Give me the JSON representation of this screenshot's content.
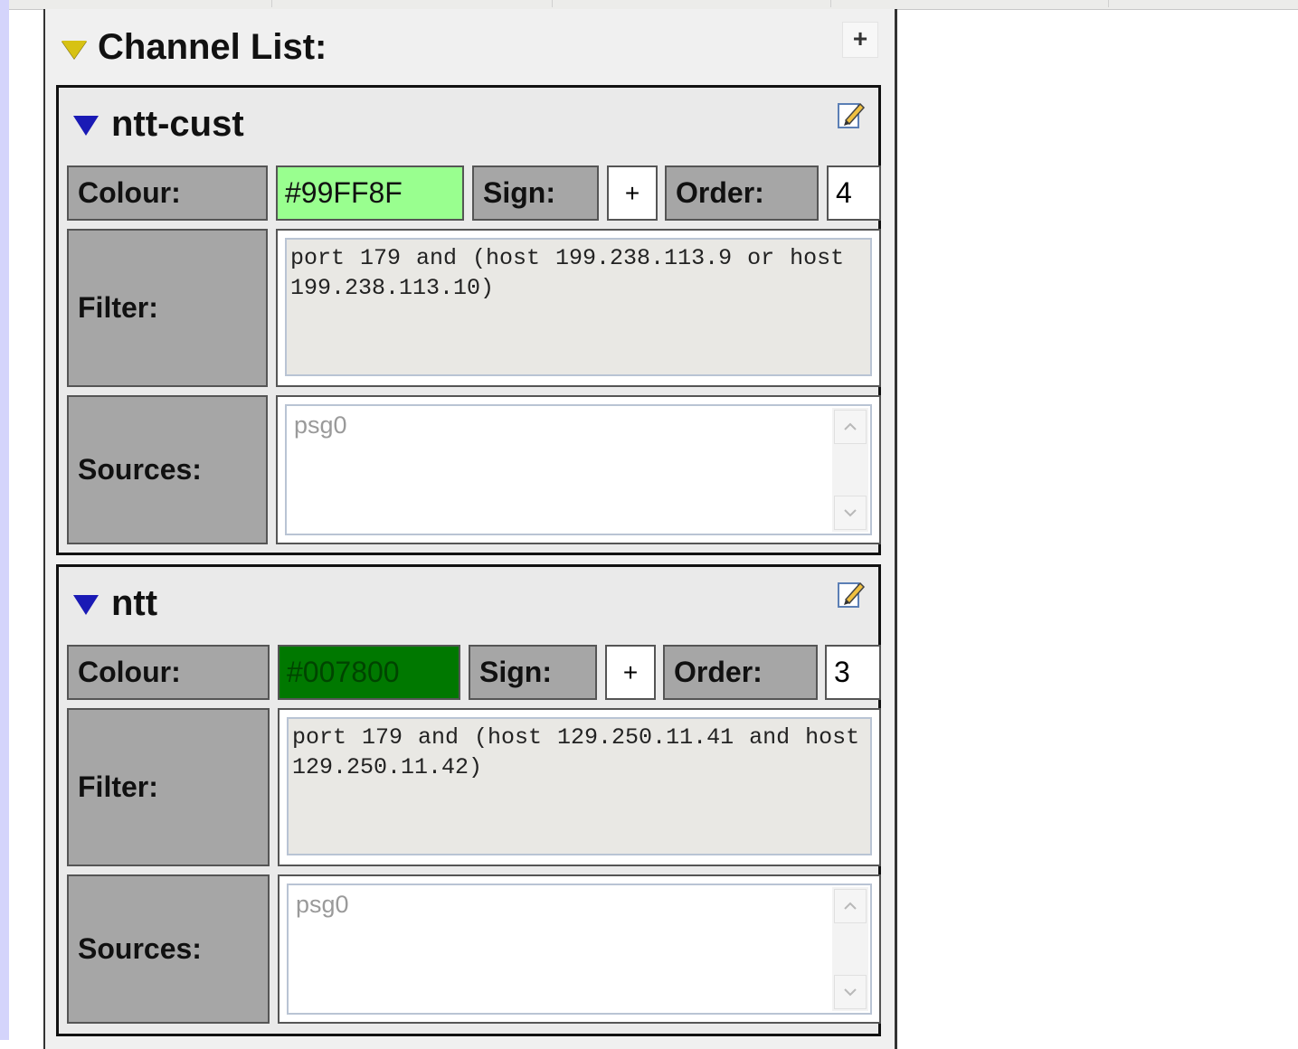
{
  "panel": {
    "title": "Channel List:",
    "add_label": "+"
  },
  "channels": [
    {
      "name": "ntt-cust",
      "colour_label": "Colour:",
      "colour_value": "#99FF8F",
      "colour_hex": "#99FF8F",
      "sign_label": "Sign:",
      "sign_value": "+",
      "order_label": "Order:",
      "order_value": "4",
      "filter_label": "Filter:",
      "filter_value": "port 179 and (host 199.238.113.9 or host 199.238.113.10)",
      "sources_label": "Sources:",
      "sources_value": "psg0"
    },
    {
      "name": "ntt",
      "colour_label": "Colour:",
      "colour_value": "#007800",
      "colour_hex": "#007800",
      "sign_label": "Sign:",
      "sign_value": "+",
      "order_label": "Order:",
      "order_value": "3",
      "filter_label": "Filter:",
      "filter_value": "port 179 and (host 129.250.11.41 and host 129.250.11.42)",
      "sources_label": "Sources:",
      "sources_value": "psg0"
    }
  ]
}
